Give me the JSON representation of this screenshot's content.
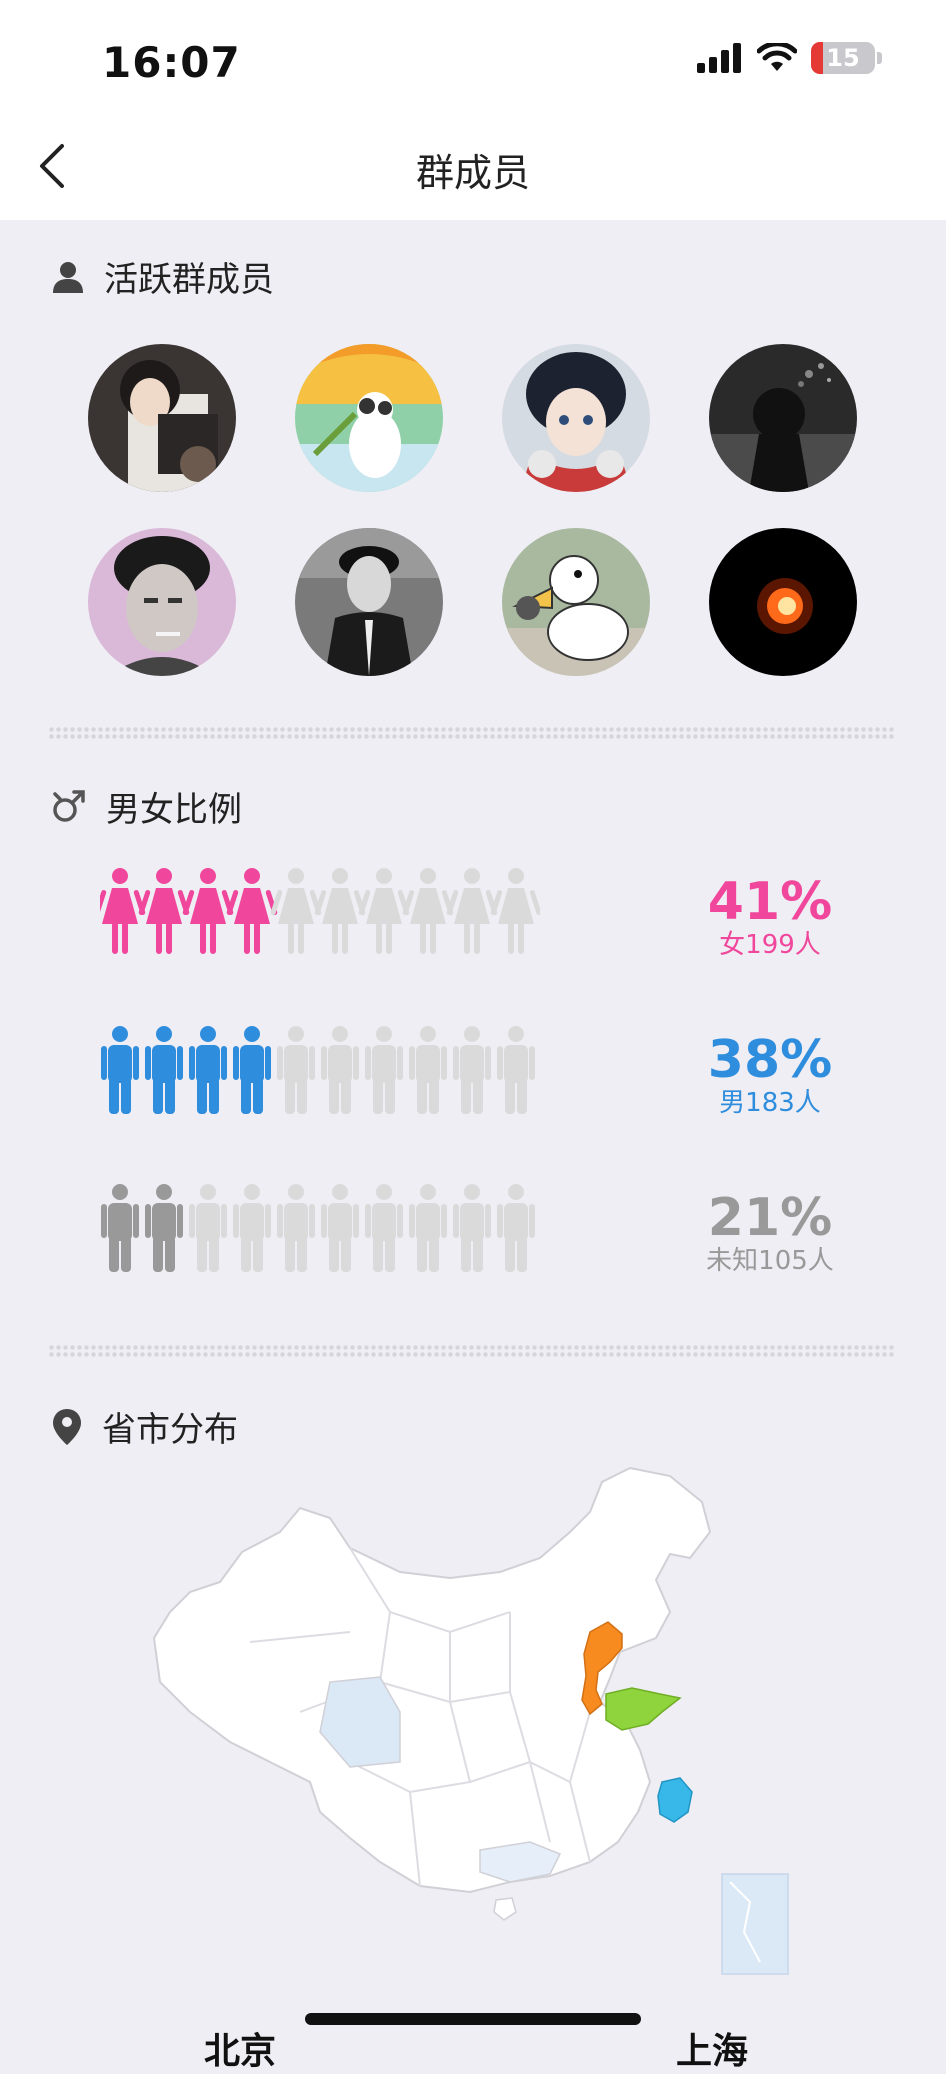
{
  "status_bar": {
    "time": "16:07",
    "battery": "15"
  },
  "nav": {
    "title": "群成员"
  },
  "active_members": {
    "title": "活跃群成员",
    "avatars": [
      {
        "name": "member-1"
      },
      {
        "name": "member-2"
      },
      {
        "name": "member-3"
      },
      {
        "name": "member-4"
      },
      {
        "name": "member-5"
      },
      {
        "name": "member-6"
      },
      {
        "name": "member-7"
      },
      {
        "name": "member-8"
      }
    ]
  },
  "gender": {
    "title": "男女比例",
    "rows": [
      {
        "percent": "41%",
        "label": "女199人",
        "filled": 4,
        "color": "#f0479c"
      },
      {
        "percent": "38%",
        "label": "男183人",
        "filled": 4,
        "color": "#2f8ddd"
      },
      {
        "percent": "21%",
        "label": "未知105人",
        "filled": 2,
        "color": "#999999"
      }
    ]
  },
  "region": {
    "title": "省市分布",
    "highlight_colors": {
      "beijing_hebei": "#f78b1f",
      "shandong": "#8fd43d",
      "zhejiang": "#37b8e8",
      "light": "#dbe9f7"
    },
    "labels": [
      "北京",
      "上海"
    ]
  }
}
